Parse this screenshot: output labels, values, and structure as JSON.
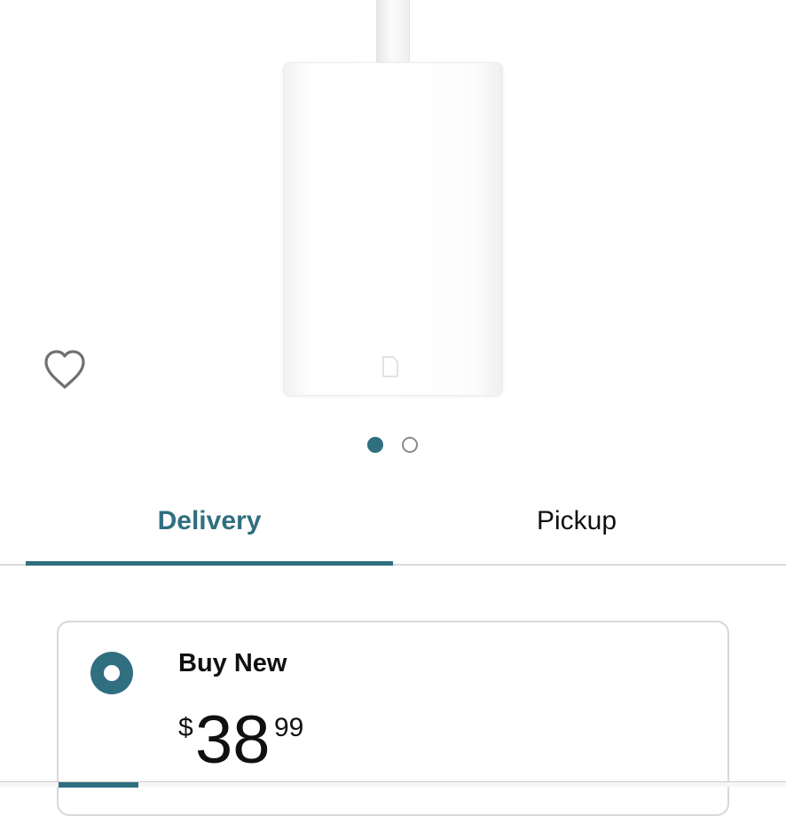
{
  "product": {
    "image_description_icon": "sd-card-icon",
    "wishlist_icon": "heart-outline-icon"
  },
  "carousel": {
    "total_images": 2,
    "active_index": 1
  },
  "tabs": {
    "items": [
      {
        "label": "Delivery",
        "active": true
      },
      {
        "label": "Pickup",
        "active": false
      }
    ]
  },
  "offer": {
    "selected": true,
    "title": "Buy New",
    "price": {
      "symbol": "$",
      "whole": "38",
      "fraction": "99"
    }
  },
  "colors": {
    "accent": "#2f6f80",
    "text": "#0f1111",
    "divider": "#d5d9d9"
  }
}
